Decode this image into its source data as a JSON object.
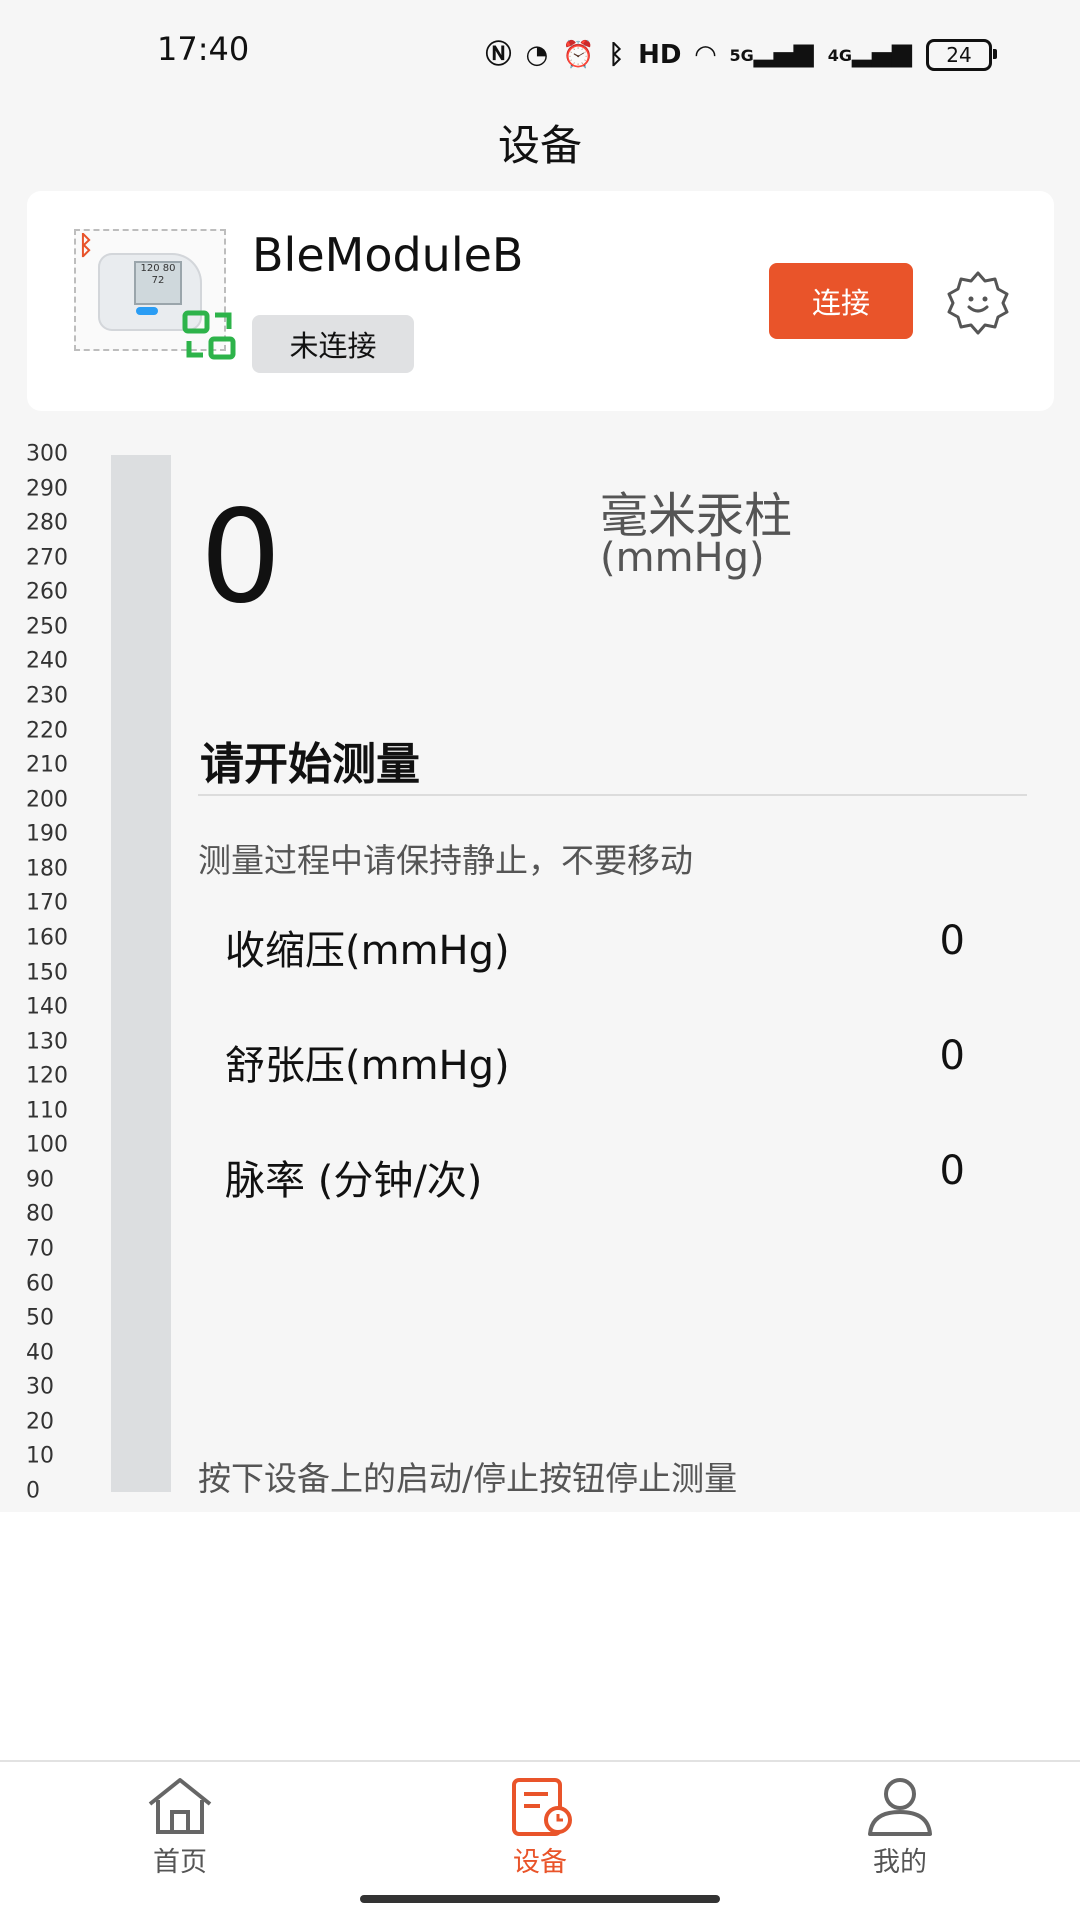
{
  "status_bar": {
    "time": "17:40",
    "icons": [
      "nfc-icon",
      "speed-icon",
      "alarm-icon",
      "bluetooth-icon",
      "hd-icon",
      "wifi-icon",
      "signal-5g-icon",
      "signal-4g-icon"
    ],
    "hd_label": "HD",
    "sig5g_label": "5G",
    "sig4g_label": "4G",
    "battery": "24"
  },
  "header": {
    "title": "设备"
  },
  "device": {
    "name": "BleModuleB",
    "status": "未连接",
    "connect_label": "连接",
    "settings_icon": "gear-icon",
    "thumb_screen": "120 80 72"
  },
  "gauge": {
    "ticks": [
      "300",
      "290",
      "280",
      "270",
      "260",
      "250",
      "240",
      "230",
      "220",
      "210",
      "200",
      "190",
      "180",
      "170",
      "160",
      "150",
      "140",
      "130",
      "120",
      "110",
      "100",
      "90",
      "80",
      "70",
      "60",
      "50",
      "40",
      "30",
      "20",
      "10",
      "0"
    ],
    "max": 300,
    "current": 0
  },
  "measurement": {
    "value": "0",
    "unit_cn": "毫米汞柱",
    "unit_en": "(mmHg)",
    "prompt": "请开始测量",
    "hint": "测量过程中请保持静止，不要移动",
    "readings": [
      {
        "label": "收缩压(mmHg)",
        "value": "0"
      },
      {
        "label": "舒张压(mmHg)",
        "value": "0"
      },
      {
        "label": "脉率 (分钟/次)",
        "value": "0"
      }
    ],
    "footer_hint": "按下设备上的启动/停止按钮停止测量"
  },
  "tabs": [
    {
      "label": "首页",
      "icon": "home-icon",
      "active": false
    },
    {
      "label": "设备",
      "icon": "device-record-icon",
      "active": true
    },
    {
      "label": "我的",
      "icon": "profile-icon",
      "active": false
    }
  ],
  "colors": {
    "accent": "#e9542a",
    "green": "#2db34a"
  }
}
